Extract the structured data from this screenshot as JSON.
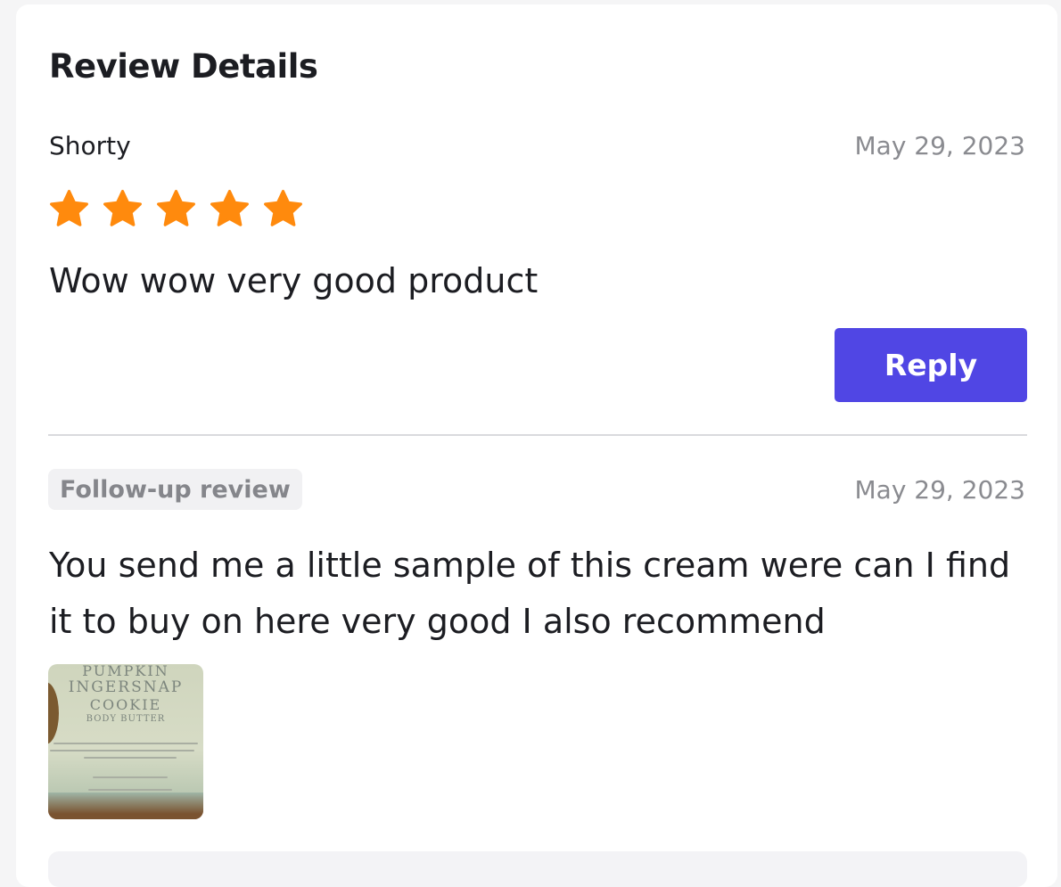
{
  "panel": {
    "title": "Review Details"
  },
  "review": {
    "author": "Shorty",
    "date": "May 29, 2023",
    "rating": 5,
    "rating_max": 5,
    "star_color": "#ff8a0d",
    "text": "Wow wow very good product",
    "reply_label": "Reply",
    "reply_color": "#5046e4"
  },
  "followup": {
    "badge": "Follow-up review",
    "date": "May 29, 2023",
    "text": "You send me a little sample of this cream were can I find it to buy on here very good I also recommend",
    "photo": {
      "line1": "PUMPKIN",
      "line2": "INGERSNAP",
      "line3": "COOKIE",
      "line4": "BODY BUTTER"
    }
  }
}
